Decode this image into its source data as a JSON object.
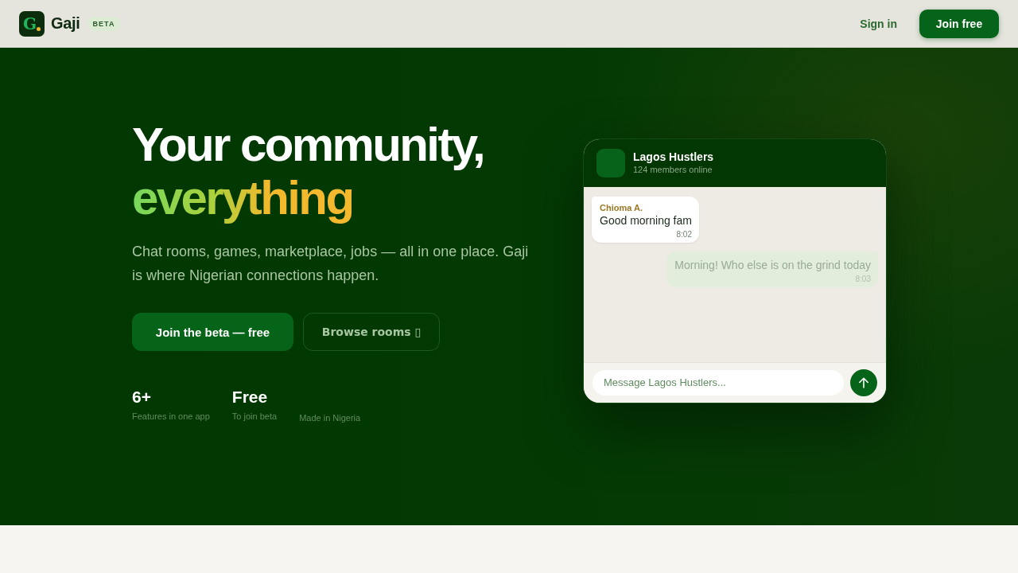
{
  "nav": {
    "logo": {
      "letter": "G",
      "name": "Gaji",
      "badge": "BETA"
    },
    "links": [
      {
        "label": "Sign in",
        "kind": "link"
      },
      {
        "label": "Join free",
        "kind": "primary"
      }
    ]
  },
  "hero": {
    "title": "Your community,",
    "highlight": "everything",
    "description": "Chat rooms, games, marketplace, jobs — all in one place. Gaji is where Nigerian connections happen.",
    "buttons": [
      {
        "label": "Join the beta — free",
        "kind": "primary"
      },
      {
        "label": "Browse rooms ▯",
        "kind": "outline"
      }
    ],
    "stats": [
      {
        "value": "6+",
        "label": "Features in one app"
      },
      {
        "value": "Free",
        "label": "To join beta"
      },
      {
        "label": "Made in Nigeria"
      }
    ]
  },
  "chat": {
    "room": "Lagos Hustlers",
    "status": "124 members online",
    "messages": [
      {
        "kind": "incoming",
        "sender": "Chioma A.",
        "text": "Good morning fam",
        "time": "8:02"
      },
      {
        "kind": "outgoing",
        "text": "Morning! Who else is on the grind today",
        "time": "8:03"
      }
    ],
    "input": {
      "placeholder": "Message Lagos Hustlers..."
    }
  }
}
